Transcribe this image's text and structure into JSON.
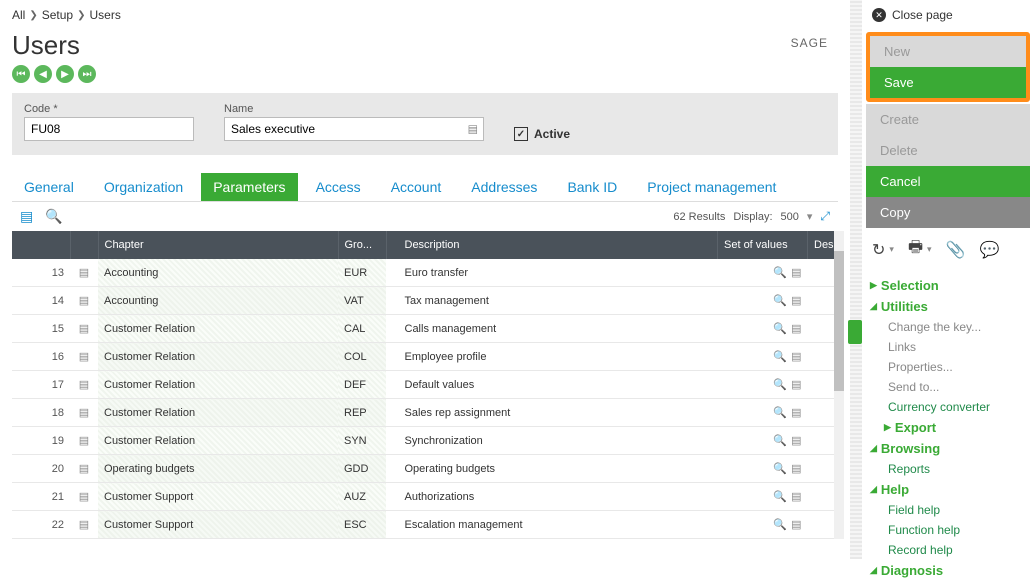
{
  "breadcrumb": [
    "All",
    "Setup",
    "Users"
  ],
  "title": "Users",
  "brand": "SAGE",
  "form": {
    "codeLabel": "Code *",
    "codeValue": "FU08",
    "nameLabel": "Name",
    "nameValue": "Sales executive",
    "activeLabel": "Active"
  },
  "tabs": [
    "General",
    "Organization",
    "Parameters",
    "Access",
    "Account",
    "Addresses",
    "Bank ID",
    "Project management"
  ],
  "activeTab": 2,
  "results": {
    "countText": "62 Results",
    "displayLabel": "Display:",
    "displayValue": "500"
  },
  "columns": {
    "chapter": "Chapter",
    "group": "Gro...",
    "description": "Description",
    "setOfValues": "Set of values",
    "des": "Des"
  },
  "rows": [
    {
      "n": "13",
      "chapter": "Accounting",
      "grp": "EUR",
      "desc": "Euro transfer"
    },
    {
      "n": "14",
      "chapter": "Accounting",
      "grp": "VAT",
      "desc": "Tax management"
    },
    {
      "n": "15",
      "chapter": "Customer Relation",
      "grp": "CAL",
      "desc": "Calls management"
    },
    {
      "n": "16",
      "chapter": "Customer Relation",
      "grp": "COL",
      "desc": "Employee profile"
    },
    {
      "n": "17",
      "chapter": "Customer Relation",
      "grp": "DEF",
      "desc": "Default values"
    },
    {
      "n": "18",
      "chapter": "Customer Relation",
      "grp": "REP",
      "desc": "Sales rep assignment"
    },
    {
      "n": "19",
      "chapter": "Customer Relation",
      "grp": "SYN",
      "desc": "Synchronization"
    },
    {
      "n": "20",
      "chapter": "Operating budgets",
      "grp": "GDD",
      "desc": "Operating budgets"
    },
    {
      "n": "21",
      "chapter": "Customer Support",
      "grp": "AUZ",
      "desc": "Authorizations"
    },
    {
      "n": "22",
      "chapter": "Customer Support",
      "grp": "ESC",
      "desc": "Escalation management"
    }
  ],
  "side": {
    "close": "Close page",
    "buttons": {
      "new": "New",
      "save": "Save",
      "create": "Create",
      "delete": "Delete",
      "cancel": "Cancel",
      "copy": "Copy"
    },
    "sections": {
      "selection": "Selection",
      "utilities": "Utilities",
      "utilItems": [
        "Change the key...",
        "Links",
        "Properties...",
        "Send to..."
      ],
      "currency": "Currency converter",
      "export": "Export",
      "browsing": "Browsing",
      "reports": "Reports",
      "help": "Help",
      "helpItems": [
        "Field help",
        "Function help",
        "Record help"
      ],
      "diagnosis": "Diagnosis"
    }
  }
}
